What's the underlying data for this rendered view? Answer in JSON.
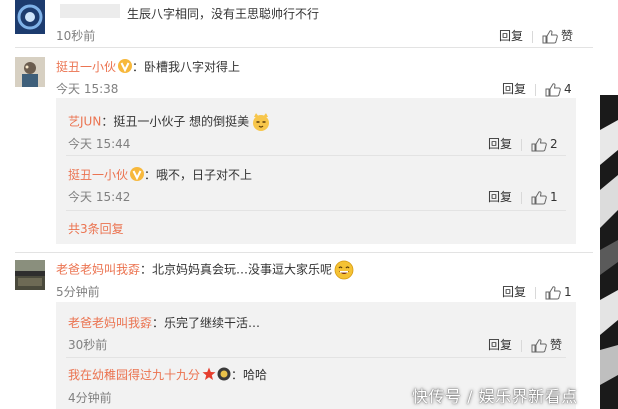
{
  "colors": {
    "name": "#eb7350",
    "time": "#808080",
    "sub_background": "#f2f2f2",
    "divider": "#e3e3e3"
  },
  "comment_top": {
    "text": "生辰八字相同，没有王思聪帅行不行",
    "time": "10秒前",
    "reply_label": "回复",
    "like_label": "赞"
  },
  "comment_main": {
    "author": "挺丑一小伙",
    "text": "卧槽我八字对得上",
    "time": "今天 15:38",
    "reply_label": "回复",
    "like_count": "4",
    "replies": [
      {
        "author": "艺JUN",
        "text": "挺丑一小伙子 想的倒挺美",
        "emoji_icon": "cat-face-icon",
        "time": "今天 15:44",
        "reply_label": "回复",
        "like_count": "2"
      },
      {
        "author": "挺丑一小伙",
        "text": "哦不，日子对不上",
        "time": "今天 15:42",
        "reply_label": "回复",
        "like_count": "1"
      }
    ],
    "more_replies": "共3条回复"
  },
  "comment_second": {
    "author": "老爸老妈叫我孬",
    "text": "北京妈妈真会玩…没事逗大家乐呢",
    "emoji_icon": "laughing-face-icon",
    "time": "5分钟前",
    "reply_label": "回复",
    "like_count": "1",
    "replies": [
      {
        "author": "老爸老妈叫我孬",
        "text": "乐完了继续干活…",
        "time": "30秒前",
        "reply_label": "回复",
        "like_label": "赞"
      },
      {
        "author": "我在幼稚园得过九十九分",
        "text": "哈哈",
        "time": "4分钟前"
      }
    ]
  },
  "watermark": "快传号 / 娱乐界新看点"
}
